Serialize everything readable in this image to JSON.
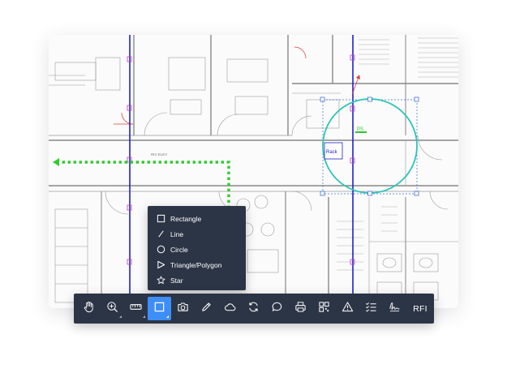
{
  "colors": {
    "toolbar_bg": "#2c3546",
    "active_tool": "#3e8ef7",
    "measurement_circle": "#2ec4b6",
    "path_arrow": "#2ecc2e",
    "grid_line": "#2020c8"
  },
  "plan": {
    "room_label": "RIV ELEV",
    "markup_tag": "PS",
    "rack_label": "Rack"
  },
  "shape_menu": {
    "items": [
      {
        "label": "Rectangle",
        "icon": "square-icon"
      },
      {
        "label": "Line",
        "icon": "line-icon"
      },
      {
        "label": "Circle",
        "icon": "circle-icon"
      },
      {
        "label": "Triangle/Polygon",
        "icon": "triangle-icon"
      },
      {
        "label": "Star",
        "icon": "star-icon"
      }
    ]
  },
  "toolbar": {
    "tools": [
      {
        "name": "pan-tool",
        "icon": "hand-icon"
      },
      {
        "name": "zoom-tool",
        "icon": "zoom-icon",
        "has_submenu": true
      },
      {
        "name": "measure-tool",
        "icon": "ruler-icon",
        "has_submenu": true
      },
      {
        "name": "shape-tool",
        "icon": "square-icon",
        "active": true,
        "has_submenu": true
      },
      {
        "name": "camera-tool",
        "icon": "camera-icon"
      },
      {
        "name": "pencil-tool",
        "icon": "pencil-icon"
      },
      {
        "name": "cloud-tool",
        "icon": "cloud-icon"
      },
      {
        "name": "sync-tool",
        "icon": "refresh-icon"
      },
      {
        "name": "comment-tool",
        "icon": "comment-icon"
      },
      {
        "name": "print-tool",
        "icon": "printer-icon"
      },
      {
        "name": "qr-tool",
        "icon": "qr-icon"
      },
      {
        "name": "warning-tool",
        "icon": "warning-icon"
      },
      {
        "name": "checklist-tool",
        "icon": "checklist-icon"
      },
      {
        "name": "signature-tool",
        "icon": "signature-icon"
      }
    ],
    "rfi_label": "RFI"
  }
}
